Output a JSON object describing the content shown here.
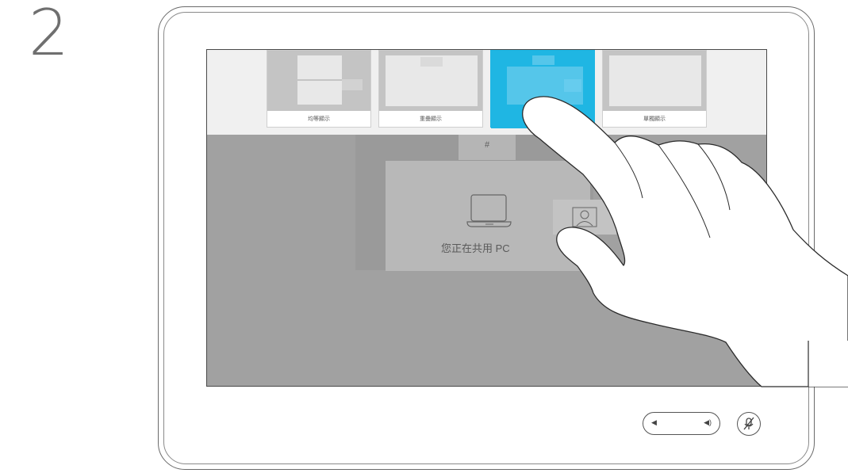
{
  "step": {
    "number": "2"
  },
  "layout_options": [
    {
      "label": "均等顯示",
      "active": false
    },
    {
      "label": "重疊顯示",
      "active": false
    },
    {
      "label": "",
      "active": true
    },
    {
      "label": "單獨顯示",
      "active": false
    }
  ],
  "main": {
    "tab_label": "#",
    "share_message": "您正在共用 PC"
  },
  "colors": {
    "accent": "#1fb6e3",
    "screen_bg": "#a1a1a1"
  },
  "icons": {
    "laptop": "laptop-icon",
    "self_view": "person-icon",
    "volume_down": "volume-down-icon",
    "volume_up": "volume-up-icon",
    "mute": "microphone-muted-icon"
  }
}
